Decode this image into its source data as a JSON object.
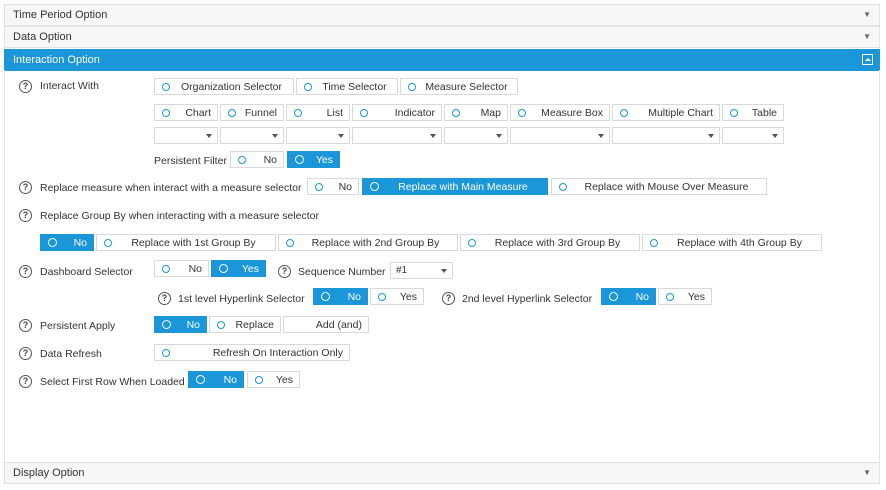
{
  "panels": {
    "time_period": "Time Period Option",
    "data": "Data Option",
    "interaction": "Interaction Option",
    "display": "Display Option"
  },
  "interact_with": {
    "label": "Interact With",
    "selectors": [
      "Organization Selector",
      "Time Selector",
      "Measure Selector"
    ],
    "widgets": [
      "Chart",
      "Funnel",
      "List",
      "Indicator",
      "Map",
      "Measure Box",
      "Multiple Chart",
      "Table"
    ]
  },
  "persistent_filter": {
    "label": "Persistent Filter",
    "no": "No",
    "yes": "Yes"
  },
  "replace_measure": {
    "label": "Replace measure when interact with a measure selector",
    "no": "No",
    "main": "Replace with Main Measure",
    "mouse": "Replace with Mouse Over Measure"
  },
  "replace_group": {
    "label": "Replace Group By when interacting with a measure selector",
    "no": "No",
    "g1": "Replace with 1st Group By",
    "g2": "Replace with 2nd Group By",
    "g3": "Replace with 3rd Group By",
    "g4": "Replace with 4th Group By"
  },
  "dashboard_selector": {
    "label": "Dashboard Selector",
    "no": "No",
    "yes": "Yes"
  },
  "sequence_number": {
    "label": "Sequence Number",
    "value": "#1"
  },
  "hyperlink1": {
    "label": "1st level Hyperlink Selector",
    "no": "No",
    "yes": "Yes"
  },
  "hyperlink2": {
    "label": "2nd level Hyperlink Selector",
    "no": "No",
    "yes": "Yes"
  },
  "persistent_apply": {
    "label": "Persistent Apply",
    "no": "No",
    "replace": "Replace",
    "add": "Add (and)"
  },
  "data_refresh": {
    "label": "Data Refresh",
    "opt": "Refresh On Interaction Only"
  },
  "select_first_row": {
    "label": "Select First Row When Loaded",
    "no": "No",
    "yes": "Yes"
  },
  "help_glyph": "?",
  "colors": {
    "accent": "#1b96d8"
  }
}
